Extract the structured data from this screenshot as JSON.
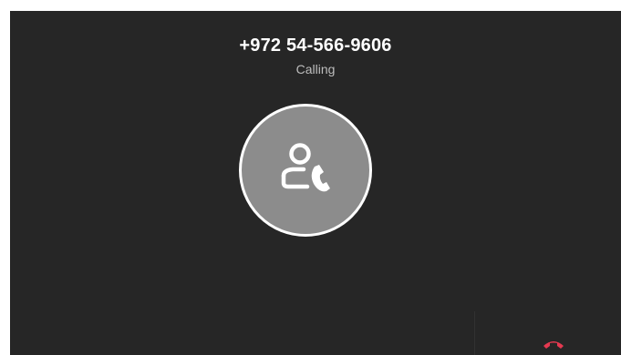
{
  "call": {
    "contact_number": "+972 54-566-9606",
    "status": "Calling"
  },
  "avatar": {
    "icon": "caller-contact-phone-icon"
  },
  "controls": {
    "end_call_icon": "hang-up-phone-icon"
  },
  "colors": {
    "background": "#262626",
    "avatar_fill": "#8c8c8c",
    "avatar_ring": "#ffffff",
    "end_call": "#e53950"
  }
}
